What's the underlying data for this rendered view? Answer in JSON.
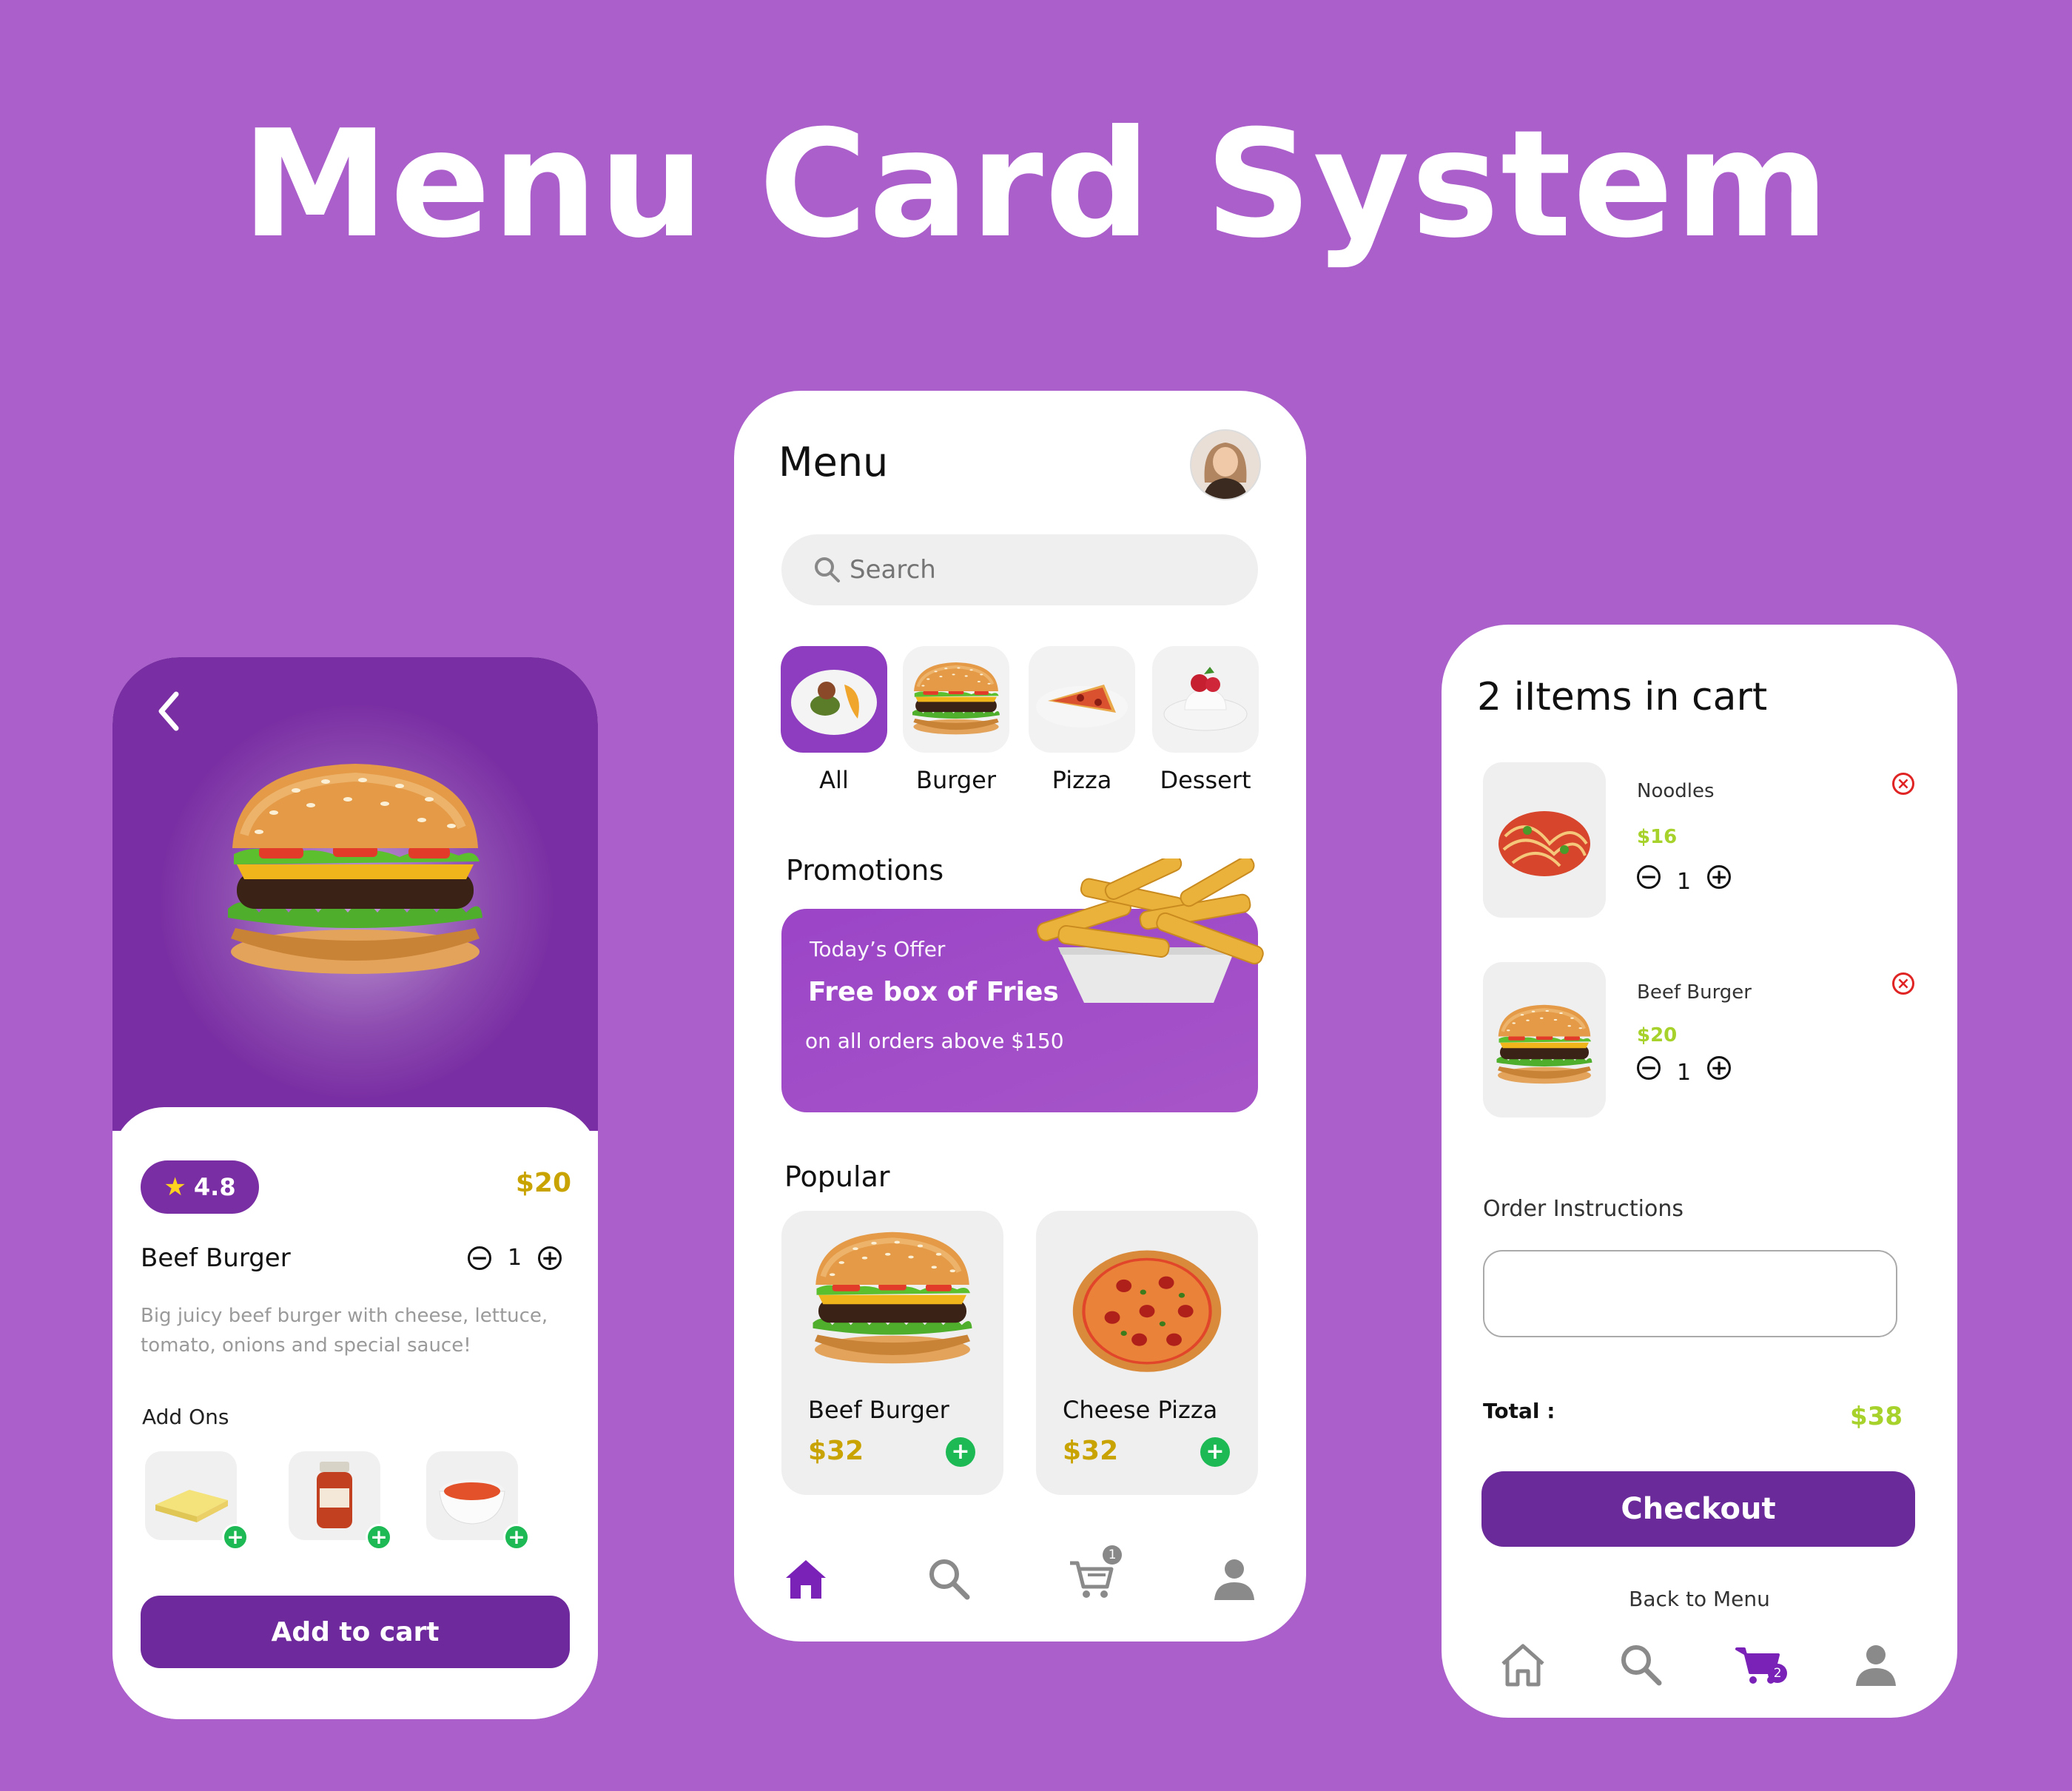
{
  "page": {
    "title": "Menu Card System"
  },
  "detail": {
    "rating": "4.8",
    "price": "$20",
    "name": "Beef Burger",
    "quantity": "1",
    "description": "Big juicy beef burger with cheese, lettuce, tomato, onions and special sauce!",
    "addons_label": "Add Ons",
    "addons": [
      "cheese-slices",
      "sauce-jar",
      "tomato-soup"
    ],
    "add_to_cart": "Add to cart"
  },
  "menu": {
    "title": "Menu",
    "search_placeholder": "Search",
    "categories": [
      {
        "label": "All",
        "active": true
      },
      {
        "label": "Burger",
        "active": false
      },
      {
        "label": "Pizza",
        "active": false
      },
      {
        "label": "Dessert",
        "active": false
      }
    ],
    "promotions_title": "Promotions",
    "promo": {
      "eyebrow": "Today’s Offer",
      "headline": "Free box of Fries",
      "subtext": "on all orders above $150"
    },
    "popular_title": "Popular",
    "popular": [
      {
        "name": "Beef Burger",
        "price": "$32"
      },
      {
        "name": "Cheese Pizza",
        "price": "$32"
      }
    ],
    "nav": {
      "cart_badge": "1",
      "active": "home",
      "icons": [
        "home-icon",
        "search-icon",
        "cart-icon",
        "user-icon"
      ]
    }
  },
  "cart": {
    "title": "2 iItems in cart",
    "items": [
      {
        "name": "Noodles",
        "price": "$16",
        "quantity": "1"
      },
      {
        "name": "Beef Burger",
        "price": "$20",
        "quantity": "1"
      }
    ],
    "order_instructions_label": "Order Instructions",
    "order_instructions_value": "",
    "total_label": "Total :",
    "total_value": "$38",
    "checkout": "Checkout",
    "back_to_menu": "Back to Menu",
    "nav": {
      "cart_badge": "2",
      "active": "cart"
    }
  },
  "colors": {
    "background": "#ab5fcb",
    "brand_purple": "#6e2a9c",
    "price_gold": "#c9a300",
    "price_lime": "#a7d22b",
    "add_green": "#1db954",
    "remove_red": "#e02424"
  }
}
